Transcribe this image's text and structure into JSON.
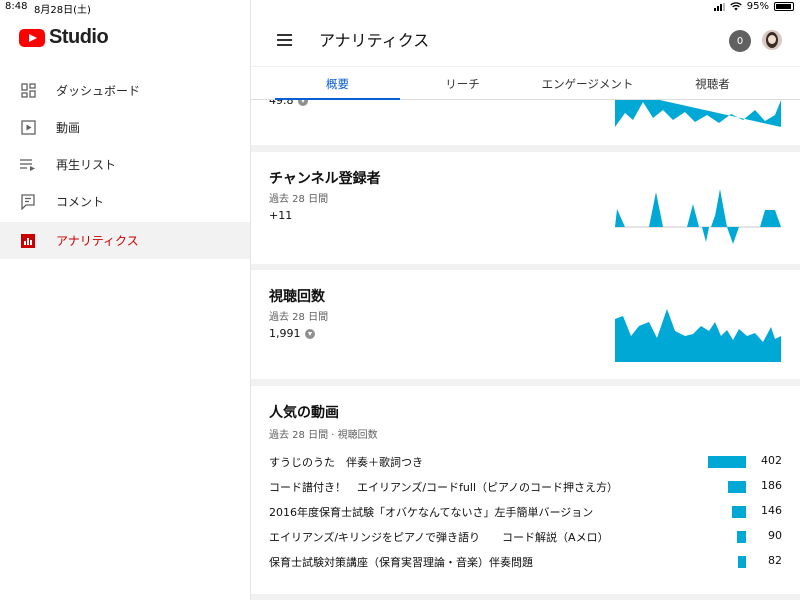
{
  "status_bar": {
    "time": "8:48",
    "date": "8月28日(土)",
    "battery": "95%"
  },
  "sidebar": {
    "brand": "Studio",
    "items": [
      {
        "label": "ダッシュボード",
        "icon": "dashboard-icon"
      },
      {
        "label": "動画",
        "icon": "video-icon"
      },
      {
        "label": "再生リスト",
        "icon": "playlist-icon"
      },
      {
        "label": "コメント",
        "icon": "comment-icon"
      },
      {
        "label": "アナリティクス",
        "icon": "analytics-icon",
        "active": true
      }
    ]
  },
  "header": {
    "title": "アナリティクス",
    "notification_count": "0"
  },
  "tabs": [
    {
      "label": "概要",
      "active": true
    },
    {
      "label": "リーチ"
    },
    {
      "label": "エンゲージメント"
    },
    {
      "label": "視聴者"
    }
  ],
  "cards": {
    "partial": {
      "value": "49.8"
    },
    "subscribers": {
      "title": "チャンネル登録者",
      "period": "過去 28 日間",
      "value": "+11"
    },
    "views": {
      "title": "視聴回数",
      "period": "過去 28 日間",
      "value": "1,991"
    },
    "top_videos": {
      "title": "人気の動画",
      "period": "過去 28 日間 · 視聴回数",
      "rows": [
        {
          "title": "すうじのうた　伴奏＋歌詞つき",
          "views": "402",
          "value": 402
        },
        {
          "title": "コード譜付き！　エイリアンズ/コードfull（ピアノのコード押さえ方）",
          "views": "186",
          "value": 186
        },
        {
          "title": "2016年度保育士試験「オバケなんてないさ」左手簡単バージョン",
          "views": "146",
          "value": 146
        },
        {
          "title": "エイリアンズ/キリンジをピアノで弾き語り　　コード解説（Aメロ）",
          "views": "90",
          "value": 90
        },
        {
          "title": "保育士試験対策講座（保育実習理論・音楽）伴奏問題",
          "views": "82",
          "value": 82
        }
      ]
    }
  },
  "colors": {
    "accent": "#065fd4",
    "chart": "#00a8d6",
    "active_nav": "#cc0000",
    "brand_red": "#ff0000"
  }
}
